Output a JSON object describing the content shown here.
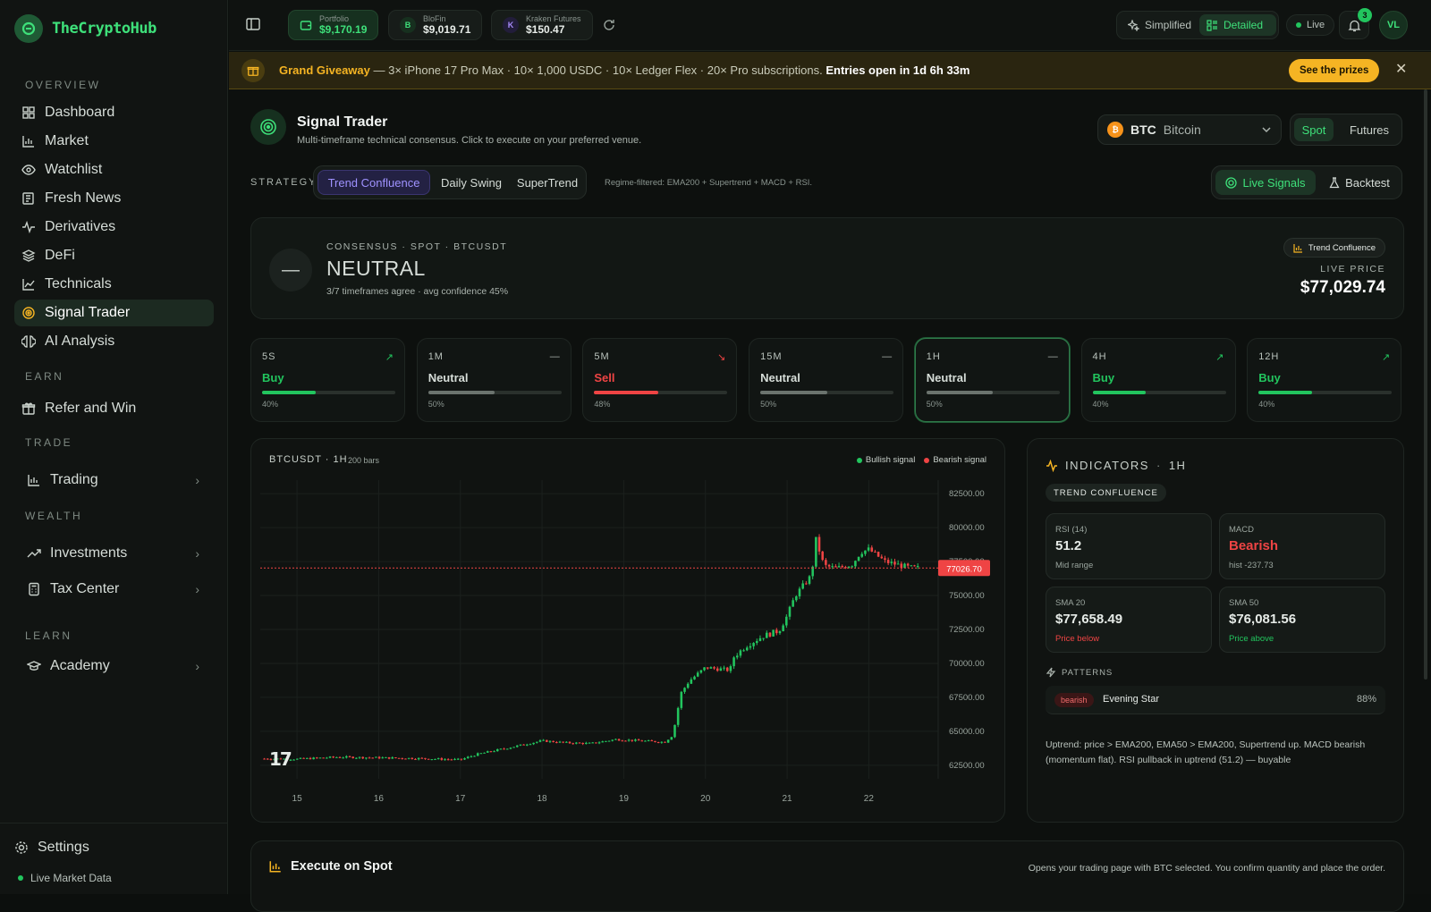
{
  "app": {
    "name": "TheCryptoHub"
  },
  "sidebar": {
    "sections": [
      "OVERVIEW",
      "EARN",
      "TRADE",
      "WEALTH",
      "LEARN"
    ],
    "overview": [
      {
        "label": "Dashboard",
        "icon": "dashboard-icon"
      },
      {
        "label": "Market",
        "icon": "market-icon"
      },
      {
        "label": "Watchlist",
        "icon": "eye-icon"
      },
      {
        "label": "Fresh News",
        "icon": "news-icon"
      },
      {
        "label": "Derivatives",
        "icon": "activity-icon"
      },
      {
        "label": "DeFi",
        "icon": "layers-icon"
      },
      {
        "label": "Technicals",
        "icon": "line-chart-icon"
      },
      {
        "label": "Signal Trader",
        "icon": "signal-icon",
        "active": true
      },
      {
        "label": "AI Analysis",
        "icon": "brain-icon"
      }
    ],
    "earn": [
      {
        "label": "Refer and Win",
        "icon": "gift-icon"
      }
    ],
    "trade": [
      {
        "label": "Trading",
        "icon": "trading-icon"
      }
    ],
    "wealth": [
      {
        "label": "Investments",
        "icon": "trend-up-icon"
      },
      {
        "label": "Tax Center",
        "icon": "calculator-icon"
      }
    ],
    "learn": [
      {
        "label": "Academy",
        "icon": "graduation-icon"
      }
    ],
    "settings_label": "Settings",
    "status_label": "Live Market Data"
  },
  "topbar": {
    "portfolio": {
      "label": "Portfolio",
      "value": "$9,170.19"
    },
    "blofin": {
      "label": "BloFin",
      "value": "$9,019.71",
      "badge": "B"
    },
    "kraken": {
      "label": "Kraken Futures",
      "value": "$150.47",
      "badge": "K"
    },
    "view_simplified": "Simplified",
    "view_detailed": "Detailed",
    "live_label": "Live",
    "notif_count": "3",
    "avatar": "VL"
  },
  "banner": {
    "title": "Grand Giveaway",
    "text": "— 3× iPhone 17 Pro Max · 10× 1,000 USDC · 10× Ledger Flex · 20× Pro subscriptions.",
    "countdown": "Entries open in 1d 6h 33m",
    "cta": "See the prizes"
  },
  "page": {
    "title": "Signal Trader",
    "subtitle": "Multi-timeframe technical consensus. Click to execute on your preferred venue.",
    "asset_symbol": "BTC",
    "asset_name": "Bitcoin",
    "market_tabs": [
      "Spot",
      "Futures"
    ],
    "strategy_label": "STRATEGY",
    "strategies": [
      "Trend Confluence",
      "Daily Swing",
      "SuperTrend"
    ],
    "strategy_note": "Regime-filtered: EMA200 + Supertrend + MACD + RSI.",
    "mode_tabs": [
      "Live Signals",
      "Backtest"
    ]
  },
  "consensus": {
    "meta": "CONSENSUS · SPOT · BTCUSDT",
    "verdict": "NEUTRAL",
    "detail": "3/7 timeframes agree · avg confidence 45%",
    "strategy_badge": "Trend Confluence",
    "price_label": "LIVE PRICE",
    "price": "$77,029.74"
  },
  "timeframes": [
    {
      "name": "5S",
      "signal": "Buy",
      "confidence": 0.4,
      "pct": "40%",
      "trend": "up"
    },
    {
      "name": "1M",
      "signal": "Neutral",
      "confidence": 0.5,
      "pct": "50%",
      "trend": "flat"
    },
    {
      "name": "5M",
      "signal": "Sell",
      "confidence": 0.48,
      "pct": "48%",
      "trend": "down"
    },
    {
      "name": "15M",
      "signal": "Neutral",
      "confidence": 0.5,
      "pct": "50%",
      "trend": "flat"
    },
    {
      "name": "1H",
      "signal": "Neutral",
      "confidence": 0.5,
      "pct": "50%",
      "trend": "flat",
      "selected": true
    },
    {
      "name": "4H",
      "signal": "Buy",
      "confidence": 0.4,
      "pct": "40%",
      "trend": "up"
    },
    {
      "name": "12H",
      "signal": "Buy",
      "confidence": 0.4,
      "pct": "40%",
      "trend": "up"
    }
  ],
  "chart": {
    "symbol": "BTCUSDT · 1H",
    "bars": "200 bars",
    "legend_bull": "Bullish signal",
    "legend_bear": "Bearish signal",
    "price_tag": "77026.70",
    "colors": {
      "up": "#22c55e",
      "down": "#ef4444"
    }
  },
  "chart_data": {
    "type": "candlestick",
    "x_ticks": [
      "15",
      "16",
      "17",
      "18",
      "19",
      "20",
      "21",
      "22"
    ],
    "y_ticks": [
      "82500.00",
      "80000.00",
      "77500.00",
      "75000.00",
      "72500.00",
      "70000.00",
      "67500.00",
      "65000.00",
      "62500.00"
    ],
    "ylim": [
      61500,
      83500
    ],
    "last_price": 77026.7,
    "close_path": [
      [
        14.6,
        62980
      ],
      [
        15.0,
        62950
      ],
      [
        15.5,
        63100
      ],
      [
        16.0,
        63050
      ],
      [
        16.5,
        63000
      ],
      [
        17.0,
        62900
      ],
      [
        17.2,
        63300
      ],
      [
        17.6,
        63800
      ],
      [
        18.0,
        64300
      ],
      [
        18.3,
        64150
      ],
      [
        18.6,
        64100
      ],
      [
        18.9,
        64400
      ],
      [
        19.2,
        64300
      ],
      [
        19.5,
        64200
      ],
      [
        19.6,
        64700
      ],
      [
        19.7,
        67800
      ],
      [
        19.8,
        68700
      ],
      [
        20.0,
        69700
      ],
      [
        20.3,
        69500
      ],
      [
        20.35,
        70500
      ],
      [
        20.5,
        71300
      ],
      [
        20.7,
        72000
      ],
      [
        20.9,
        72400
      ],
      [
        21.0,
        73500
      ],
      [
        21.1,
        75000
      ],
      [
        21.3,
        76500
      ],
      [
        21.35,
        79200
      ],
      [
        21.45,
        77200
      ],
      [
        21.6,
        77000
      ],
      [
        21.8,
        77300
      ],
      [
        21.9,
        78200
      ],
      [
        22.0,
        78400
      ],
      [
        22.2,
        77500
      ],
      [
        22.5,
        77050
      ],
      [
        22.6,
        77027
      ]
    ],
    "grid": true
  },
  "indicators": {
    "title": "INDICATORS",
    "timeframe": "1H",
    "strategy_chip": "TREND CONFLUENCE",
    "rsi": {
      "label": "RSI (14)",
      "value": "51.2",
      "note": "Mid range"
    },
    "macd": {
      "label": "MACD",
      "value": "Bearish",
      "note": "hist -237.73"
    },
    "sma20": {
      "label": "SMA 20",
      "value": "$77,658.49",
      "note": "Price below"
    },
    "sma50": {
      "label": "SMA 50",
      "value": "$76,081.56",
      "note": "Price above"
    },
    "patterns_label": "PATTERNS",
    "pattern": {
      "tag": "bearish",
      "name": "Evening Star",
      "confidence": "88%"
    },
    "summary": "Uptrend: price > EMA200, EMA50 > EMA200, Supertrend up. MACD bearish (momentum flat). RSI pullback in uptrend (51.2) — buyable"
  },
  "execute": {
    "title": "Execute on Spot",
    "note": "Opens your trading page with BTC selected. You confirm quantity and place the order."
  }
}
